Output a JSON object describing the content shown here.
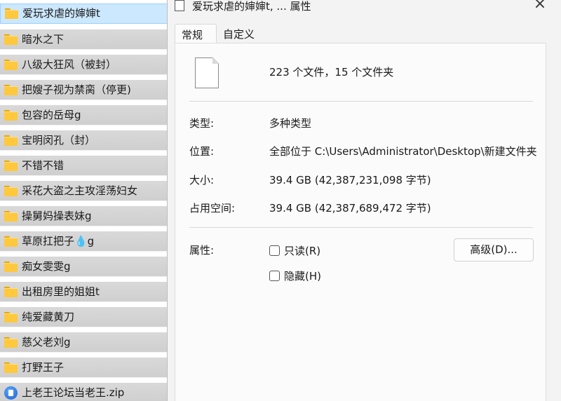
{
  "file_list": {
    "items": [
      {
        "label": "爱玩求虐的婶婶t",
        "icon": "folder-icon",
        "selected": true
      },
      {
        "label": "暗水之下",
        "icon": "folder-icon"
      },
      {
        "label": "八级大狂风（被封）",
        "icon": "folder-icon"
      },
      {
        "label": "把嫂子视为禁脔（停更)",
        "icon": "folder-icon"
      },
      {
        "label": "包容的岳母g",
        "icon": "folder-icon"
      },
      {
        "label": "宝明闵孔（封）",
        "icon": "folder-icon"
      },
      {
        "label": "不错不错",
        "icon": "folder-icon"
      },
      {
        "label": "采花大盗之主攻淫荡妇女",
        "icon": "folder-icon"
      },
      {
        "label": "操舅妈操表妹g",
        "icon": "folder-icon"
      },
      {
        "label": "草原扛把子💧g",
        "icon": "folder-icon"
      },
      {
        "label": "痴女雯雯g",
        "icon": "folder-icon"
      },
      {
        "label": "出租房里的姐姐t",
        "icon": "folder-icon"
      },
      {
        "label": "纯爱藏黄刀",
        "icon": "folder-icon"
      },
      {
        "label": "慈父老刘g",
        "icon": "folder-icon"
      },
      {
        "label": "打野王子",
        "icon": "folder-icon"
      },
      {
        "label": "上老王论坛当老王.zip",
        "icon": "zip-icon"
      }
    ]
  },
  "dialog": {
    "title": "爱玩求虐的婶婶t, ... 属性",
    "close_symbol": "×",
    "tabs": [
      {
        "label": "常规",
        "active": true
      },
      {
        "label": "自定义",
        "active": false
      }
    ],
    "summary": "223 个文件，15 个文件夹",
    "type_label": "类型:",
    "type_value": "多种类型",
    "location_label": "位置:",
    "location_value": "全部位于 C:\\Users\\Administrator\\Desktop\\新建文件夹",
    "size_label": "大小:",
    "size_value": "39.4 GB (42,387,231,098 字节)",
    "disk_size_label": "占用空间:",
    "disk_size_value": "39.4 GB (42,387,689,472 字节)",
    "attributes_label": "属性:",
    "readonly_label": "只读(R)",
    "hidden_label": "隐藏(H)",
    "advanced_button": "高级(D)..."
  },
  "colors": {
    "selection": "#cce8ff",
    "folder": "#ffc83d",
    "row_background": "#d4d4d4",
    "dialog_background": "#f3f3f3"
  }
}
